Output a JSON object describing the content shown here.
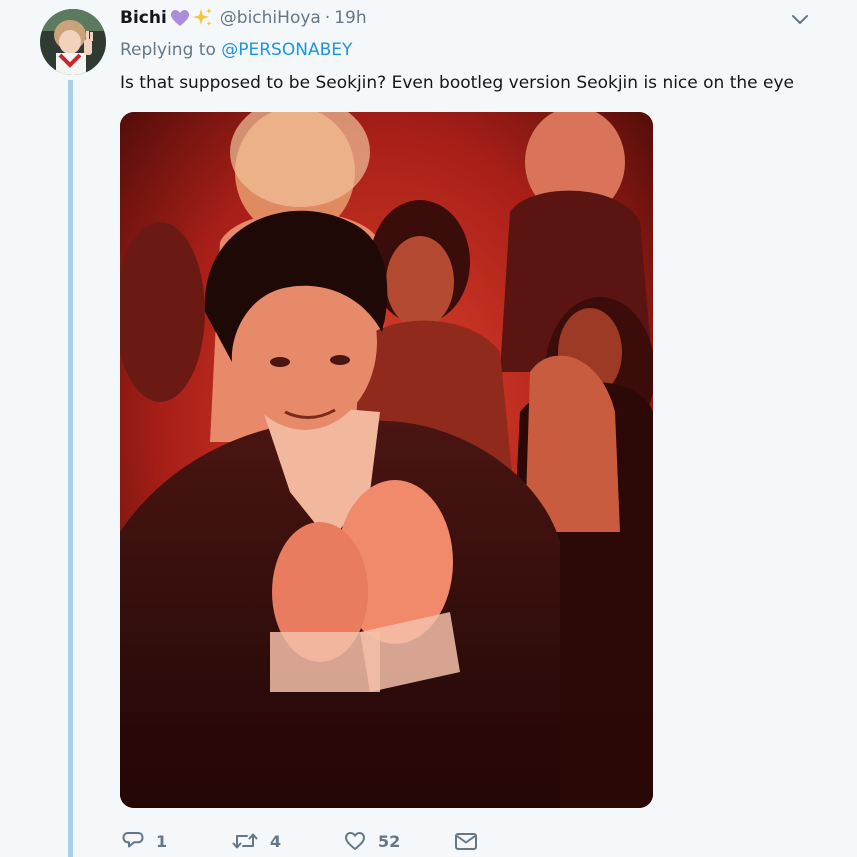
{
  "tweet": {
    "display_name": "Bichi",
    "handle": "@bichiHoya",
    "separator": "·",
    "time": "19h",
    "replying_prefix": "Replying to ",
    "replying_to": "@PERSONABEY",
    "text": "Is that supposed to be Seokjin? Even bootleg version Seokjin is nice on the eye",
    "emoji": [
      "purple-heart",
      "sparkles"
    ]
  },
  "actions": {
    "reply_count": "1",
    "retweet_count": "4",
    "like_count": "52"
  },
  "colors": {
    "background": "#f5f8fa",
    "link": "#1b95e0",
    "secondary_text": "#657786",
    "thread_line": "#a9d0e6",
    "heart": "#ab8ed8",
    "sparkle": "#f7c33c"
  },
  "icons": {
    "reply": "reply-icon",
    "retweet": "retweet-icon",
    "like": "heart-icon",
    "dm": "envelope-icon",
    "menu": "chevron-down-icon"
  }
}
